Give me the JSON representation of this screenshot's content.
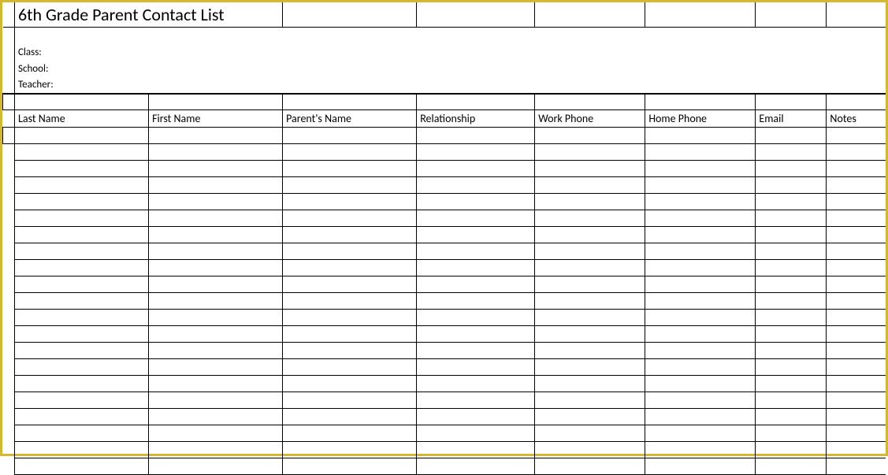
{
  "title": "6th Grade Parent Contact List",
  "meta": {
    "class_label": "Class:",
    "school_label": "School:",
    "teacher_label": "Teacher:"
  },
  "columns": [
    "Last Name",
    "First Name",
    "Parent's Name",
    "Relationship",
    "Work Phone",
    "Home Phone",
    "Email",
    "Notes"
  ],
  "data_row_count": 20
}
